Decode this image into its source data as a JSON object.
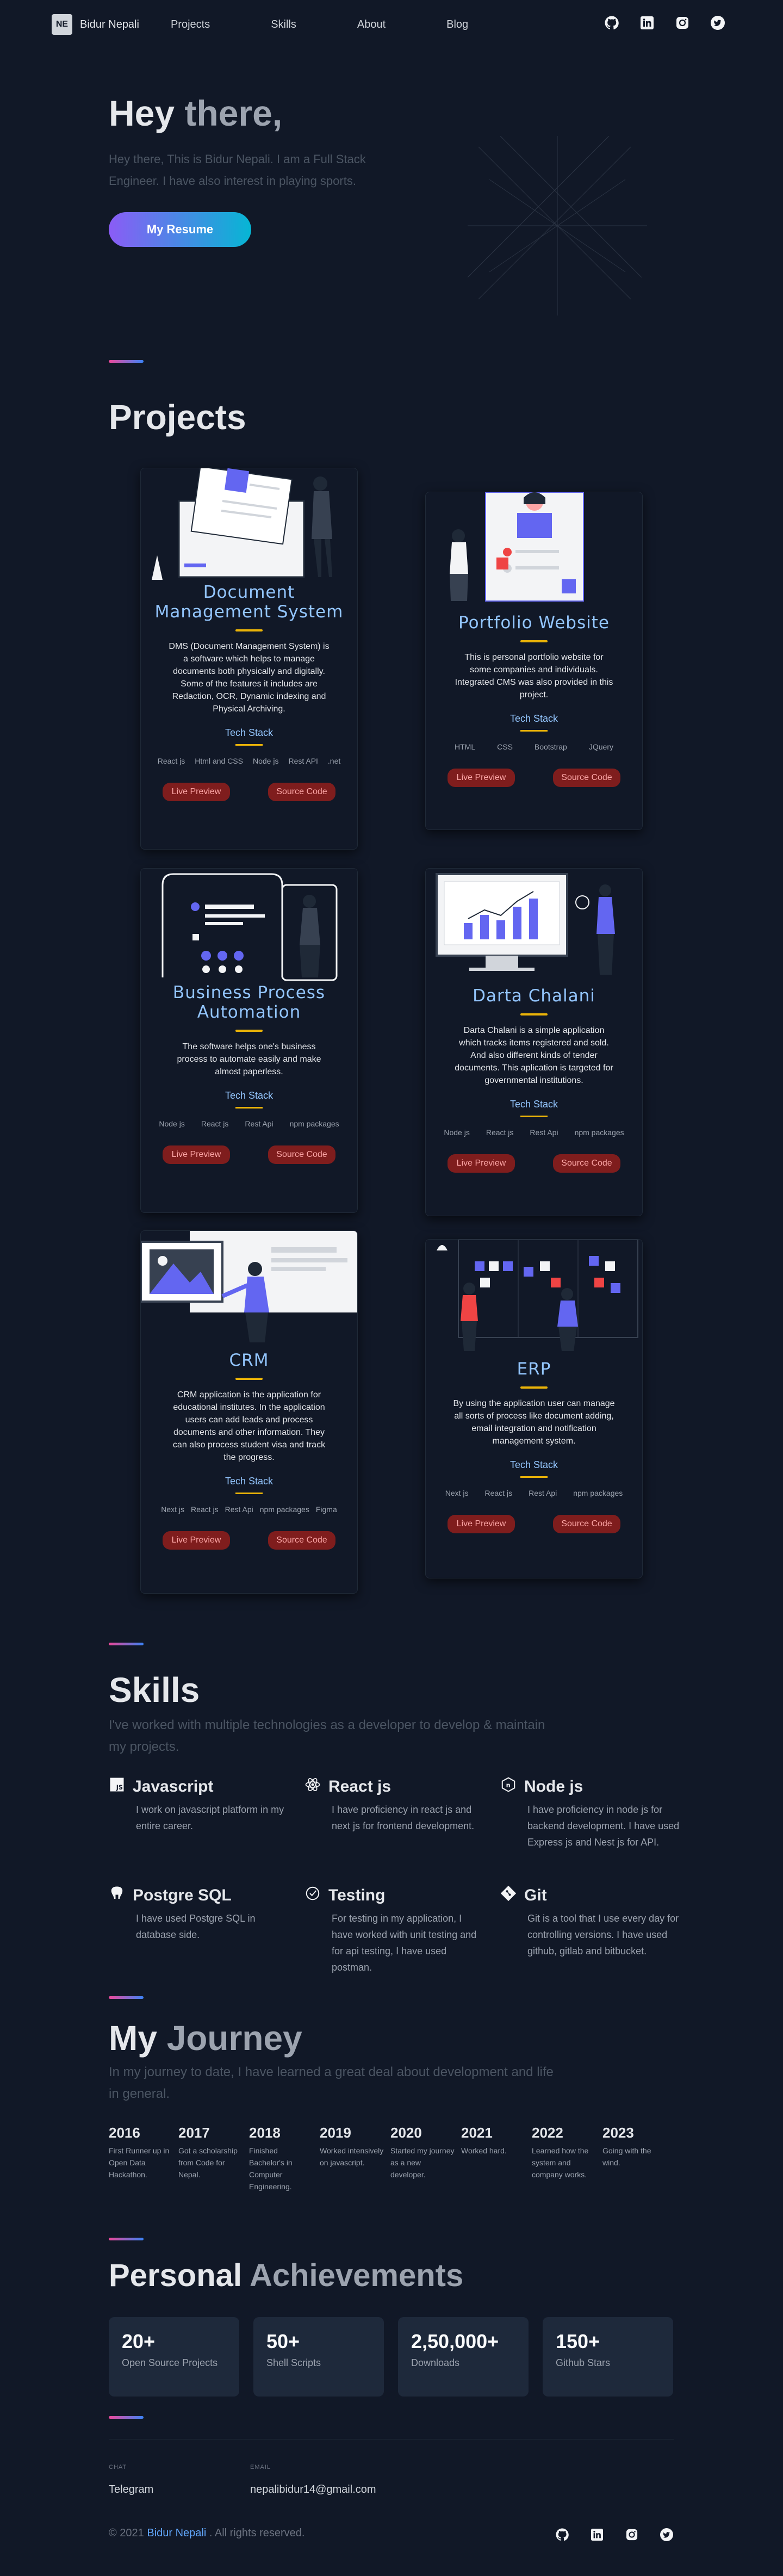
{
  "nav": {
    "logo": "NE",
    "brand": "Bidur Nepali",
    "links": [
      "Projects",
      "Skills",
      "About",
      "Blog"
    ]
  },
  "hero": {
    "title_a": "Hey ",
    "title_b": "there,",
    "text": "Hey there, This is Bidur Nepali. I am a Full Stack Engineer. I have also interest in playing sports.",
    "button": "My Resume"
  },
  "projects": {
    "title": "Projects",
    "items": [
      {
        "title": "Document Management System",
        "desc": "DMS (Document Management System) is a software which helps to manage documents both physically and digitally. Some of the features it includes are Redaction, OCR, Dynamic indexing and Physical Archiving.",
        "stack": [
          "React js",
          "Html and CSS",
          "Node js",
          "Rest API",
          ".net"
        ]
      },
      {
        "title": "Portfolio Website",
        "desc": "This is personal portfolio website for some companies and individuals. Integrated CMS was also provided in this project.",
        "stack": [
          "HTML",
          "CSS",
          "Bootstrap",
          "JQuery"
        ]
      },
      {
        "title": "Business Process Automation",
        "desc": "The software helps one's business process to automate easily and make almost paperless.",
        "stack": [
          "Node js",
          "React js",
          "Rest Api",
          "npm packages"
        ]
      },
      {
        "title": "Darta Chalani",
        "desc": "Darta Chalani is a simple application which tracks items registered and sold. And also different kinds of tender documents. This aplication is targeted for governmental institutions.",
        "stack": [
          "Node js",
          "React js",
          "Rest Api",
          "npm packages"
        ]
      },
      {
        "title": "CRM",
        "desc": "CRM application is the application for educational institutes. In the application users can add leads and process documents and other information. They can also process student visa and track the progress.",
        "stack": [
          "Next js",
          "React js",
          "Rest Api",
          "npm packages",
          "Figma"
        ]
      },
      {
        "title": "ERP",
        "desc": "By using the application user can manage all sorts of process like document adding, email integration and notification management system.",
        "stack": [
          "Next js",
          "React js",
          "Rest Api",
          "npm packages"
        ]
      }
    ],
    "tech_stack_label": "Tech Stack",
    "live_label": "Live Preview",
    "source_label": "Source Code"
  },
  "skills": {
    "title": "Skills",
    "sub": "I've worked with multiple technologies as a developer to develop & maintain my projects.",
    "items": [
      {
        "name": "Javascript",
        "text": "I work on javascript platform in my entire career."
      },
      {
        "name": "React js",
        "text": "I have proficiency in react js and next js for frontend development."
      },
      {
        "name": "Node js",
        "text": "I have proficiency in node js for backend development. I have used Express js and Nest js for API."
      },
      {
        "name": "Postgre SQL",
        "text": "I have used Postgre SQL in database side."
      },
      {
        "name": "Testing",
        "text": "For testing in my application, I have worked with unit testing and for api testing, I have used postman."
      },
      {
        "name": "Git",
        "text": "Git is a tool that I use every day for controlling versions. I have used github, gitlab and bitbucket."
      }
    ]
  },
  "journey": {
    "title_a": "My ",
    "title_b": "Journey",
    "sub": "In my journey to date, I have learned a great deal about development and life in general.",
    "items": [
      {
        "year": "2016",
        "text": "First Runner up in Open Data Hackathon."
      },
      {
        "year": "2017",
        "text": "Got a scholarship from Code for Nepal."
      },
      {
        "year": "2018",
        "text": "Finished Bachelor's in Computer Engineering."
      },
      {
        "year": "2019",
        "text": "Worked intensively on javascript."
      },
      {
        "year": "2020",
        "text": "Started my journey as a new developer."
      },
      {
        "year": "2021",
        "text": "Worked hard."
      },
      {
        "year": "2022",
        "text": "Learned how the system and company works."
      },
      {
        "year": "2023",
        "text": "Going with the wind."
      }
    ]
  },
  "achievements": {
    "title_a": "Personal ",
    "title_b": "Achievements",
    "items": [
      {
        "num": "20+",
        "label": "Open Source Projects"
      },
      {
        "num": "50+",
        "label": "Shell Scripts"
      },
      {
        "num": "2,50,000+",
        "label": "Downloads"
      },
      {
        "num": "150+",
        "label": "Github Stars"
      }
    ]
  },
  "footer": {
    "chat_label": "CHAT",
    "chat_value": "Telegram",
    "email_label": "EMAIL",
    "email_value": "nepalibidur14@gmail.com",
    "copy_a": "© 2021 ",
    "copy_name": "Bidur Nepali",
    "copy_b": " . All rights reserved."
  },
  "icons": [
    "github-icon",
    "linkedin-icon",
    "instagram-icon",
    "twitter-icon"
  ]
}
